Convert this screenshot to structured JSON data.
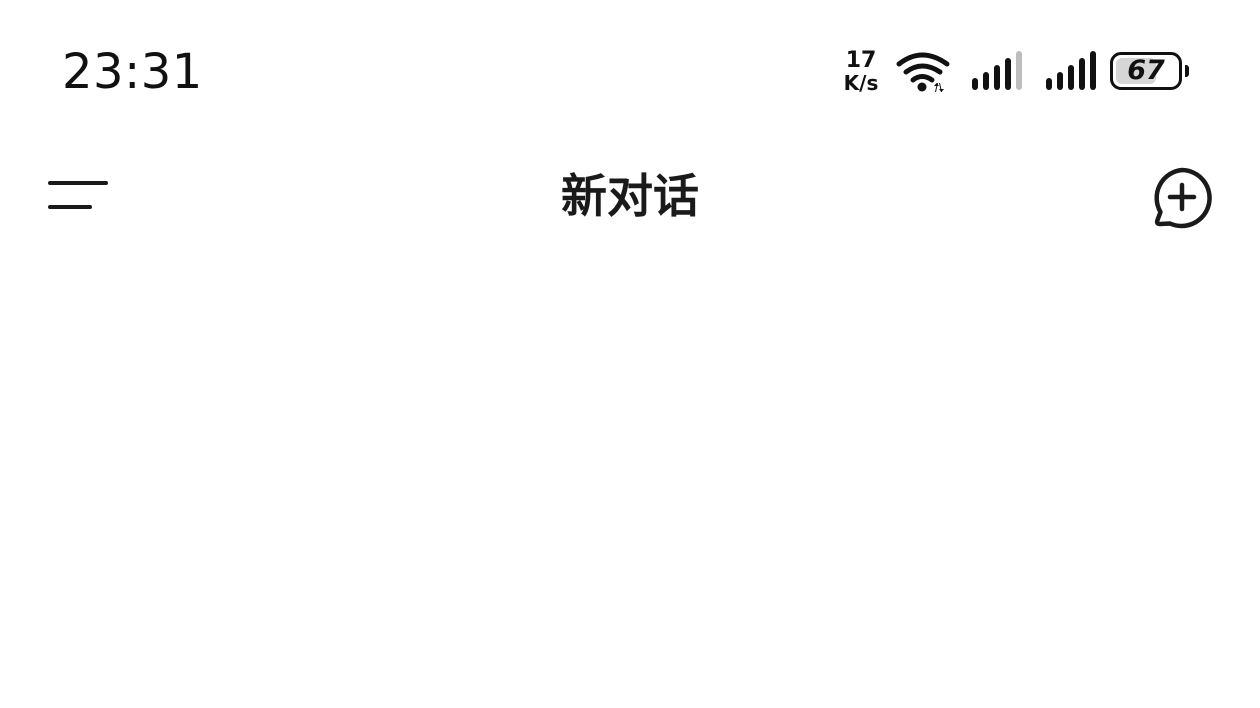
{
  "status_bar": {
    "time": "23:31",
    "net_speed_value": "17",
    "net_speed_unit": "K/s",
    "wifi_icon": "wifi-icon",
    "signal_icon": "cellular-signal-icon",
    "battery_level": "67",
    "battery_fraction": 0.67
  },
  "header": {
    "title": "新对话",
    "menu_icon": "menu-icon",
    "new_chat_icon": "new-chat-plus-icon"
  },
  "colors": {
    "text": "#1a1a1a",
    "background": "#ffffff",
    "battery_fill": "#d6d6d6",
    "signal_dim": "#bdbdbd"
  }
}
